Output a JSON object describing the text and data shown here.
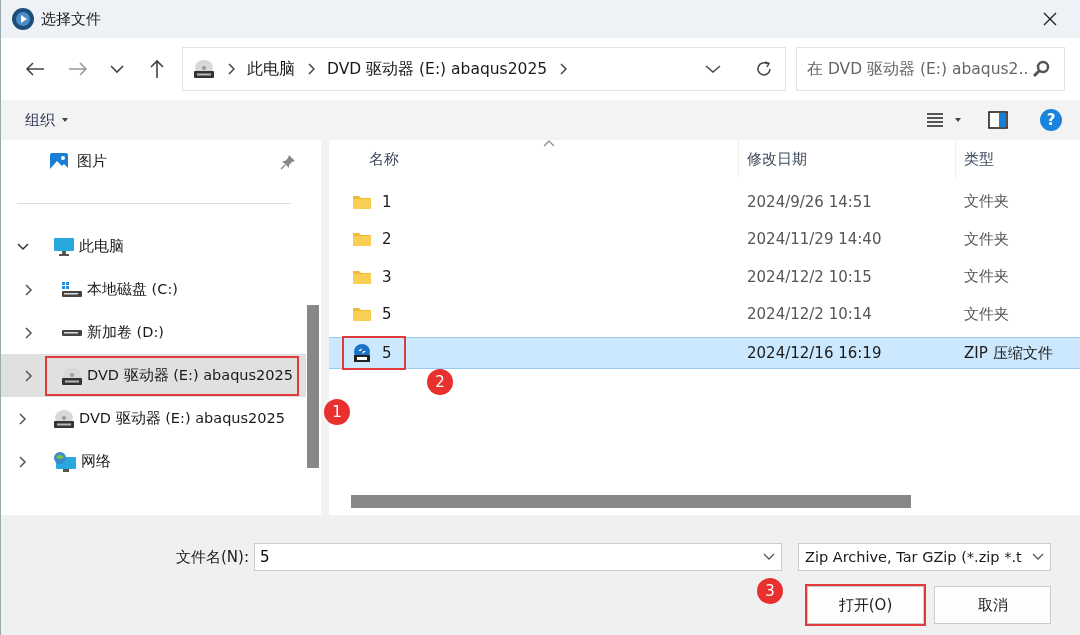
{
  "window": {
    "title": "选择文件"
  },
  "nav": {
    "breadcrumb": [
      "此电脑",
      "DVD 驱动器 (E:) abaqus2025"
    ],
    "search": {
      "placeholder": "在 DVD 驱动器 (E:) abaqus2..."
    }
  },
  "toolbar": {
    "organize": "组织",
    "help": "?"
  },
  "sidebar": {
    "quick_access": [
      {
        "label": "图片",
        "kind": "pictures",
        "pinned": true
      }
    ],
    "items": [
      {
        "label": "此电脑",
        "kind": "pc",
        "expanded": true,
        "selected": false,
        "children": [
          {
            "label": "本地磁盘 (C:)",
            "kind": "windrive",
            "expanded": false,
            "selected": false
          },
          {
            "label": "新加卷 (D:)",
            "kind": "drive",
            "expanded": false,
            "selected": false
          },
          {
            "label": "DVD 驱动器 (E:) abaqus2025",
            "kind": "dvd",
            "expanded": false,
            "selected": true,
            "annotation": "1"
          }
        ]
      },
      {
        "label": "DVD 驱动器 (E:) abaqus2025",
        "kind": "dvd",
        "expanded": false,
        "selected": false
      },
      {
        "label": "网络",
        "kind": "network",
        "expanded": false,
        "selected": false
      }
    ]
  },
  "files": {
    "columns": [
      {
        "label": "名称",
        "sorted": true
      },
      {
        "label": "修改日期",
        "sorted": false
      },
      {
        "label": "类型",
        "sorted": false
      }
    ],
    "rows": [
      {
        "kind": "folder",
        "name": "1",
        "modified": "2024/9/26 14:51",
        "type": "文件夹",
        "selected": false
      },
      {
        "kind": "folder",
        "name": "2",
        "modified": "2024/11/29 14:40",
        "type": "文件夹",
        "selected": false
      },
      {
        "kind": "folder",
        "name": "3",
        "modified": "2024/12/2 10:15",
        "type": "文件夹",
        "selected": false
      },
      {
        "kind": "folder",
        "name": "5",
        "modified": "2024/12/2 10:14",
        "type": "文件夹",
        "selected": false
      },
      {
        "kind": "zip",
        "name": "5",
        "modified": "2024/12/16 16:19",
        "type": "ZIP 压缩文件",
        "selected": true,
        "annotation": "2"
      }
    ]
  },
  "footer": {
    "filename_label": "文件名(N):",
    "filename": "5",
    "filter": "Zip Archive, Tar GZip (*.zip *.t",
    "buttons": [
      {
        "label": "打开(O)",
        "annotation": "3"
      },
      {
        "label": "取消"
      }
    ]
  }
}
